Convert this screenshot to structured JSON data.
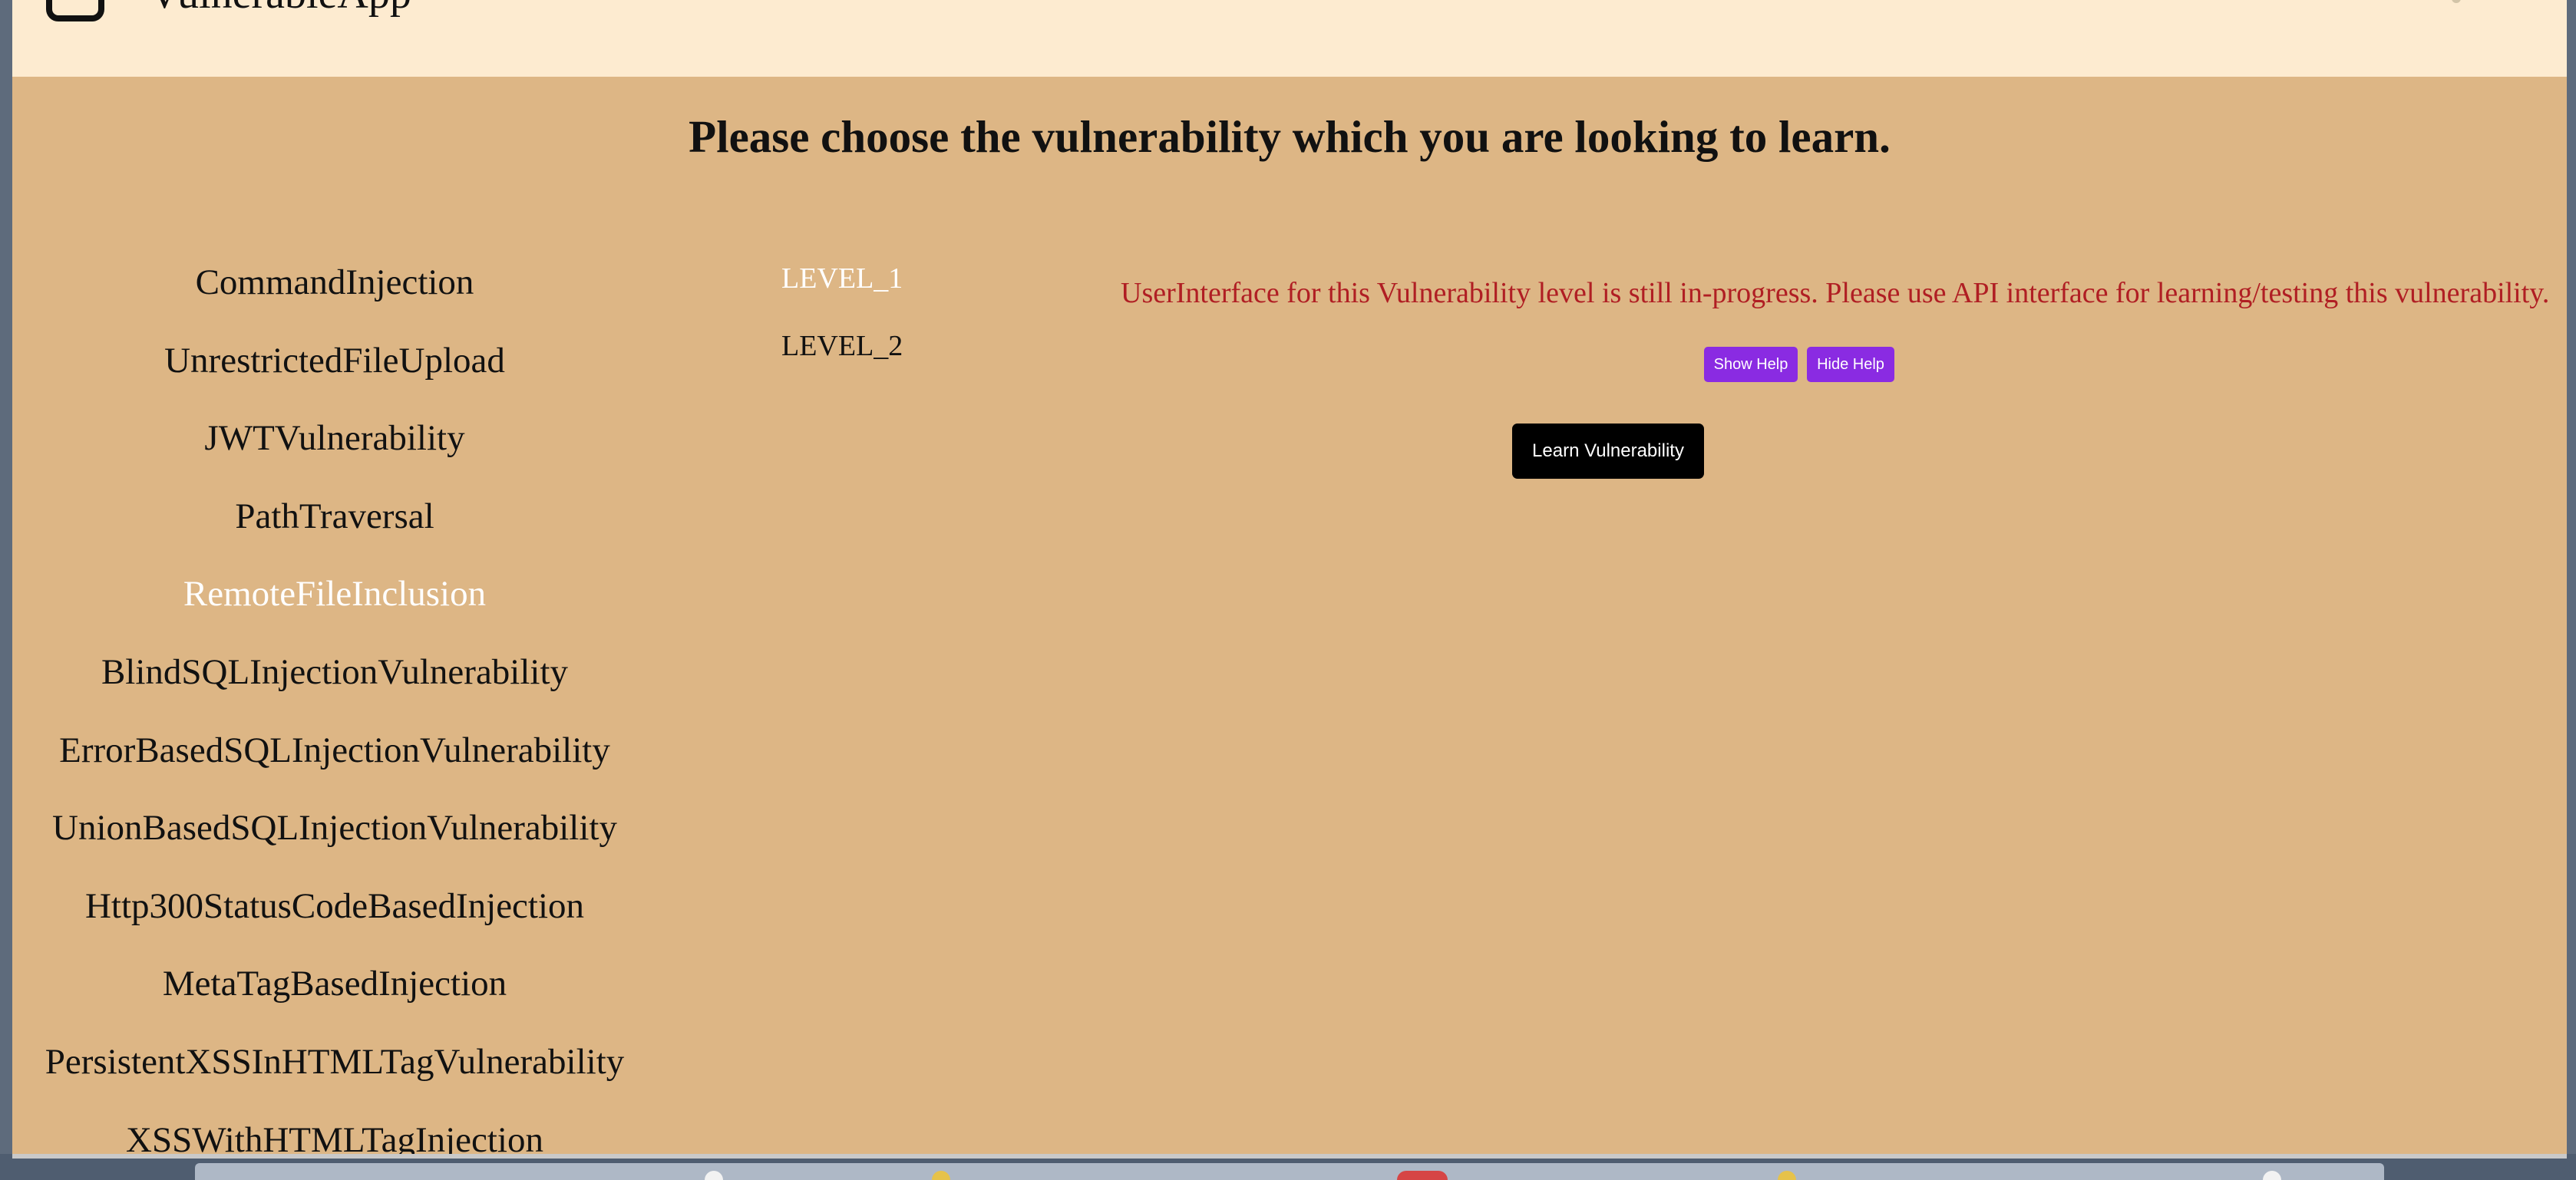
{
  "header": {
    "app_title": "VulnerableApp"
  },
  "main": {
    "heading": "Please choose the vulnerability which you are looking to learn.",
    "vulnerabilities": [
      {
        "label": "CommandInjection",
        "selected": false
      },
      {
        "label": "UnrestrictedFileUpload",
        "selected": false
      },
      {
        "label": "JWTVulnerability",
        "selected": false
      },
      {
        "label": "PathTraversal",
        "selected": false
      },
      {
        "label": "RemoteFileInclusion",
        "selected": true
      },
      {
        "label": "BlindSQLInjectionVulnerability",
        "selected": false
      },
      {
        "label": "ErrorBasedSQLInjectionVulnerability",
        "selected": false
      },
      {
        "label": "UnionBasedSQLInjectionVulnerability",
        "selected": false
      },
      {
        "label": "Http300StatusCodeBasedInjection",
        "selected": false
      },
      {
        "label": "MetaTagBasedInjection",
        "selected": false
      },
      {
        "label": "PersistentXSSInHTMLTagVulnerability",
        "selected": false
      },
      {
        "label": "XSSWithHTMLTagInjection",
        "selected": false
      }
    ],
    "levels": [
      {
        "label": "LEVEL_1",
        "selected": true
      },
      {
        "label": "LEVEL_2",
        "selected": false
      }
    ],
    "status_message": "UserInterface for this Vulnerability level is still in-progress. Please use API interface for learning/testing this vulnerability.",
    "show_help_label": "Show Help",
    "hide_help_label": "Hide Help",
    "learn_label": "Learn Vulnerability"
  },
  "colors": {
    "header_bg": "#fdebd0",
    "content_bg": "#ddb685",
    "selected_text": "#ffffff",
    "status_text": "#b01e23",
    "help_button": "#8a2be2",
    "learn_button": "#000000"
  }
}
